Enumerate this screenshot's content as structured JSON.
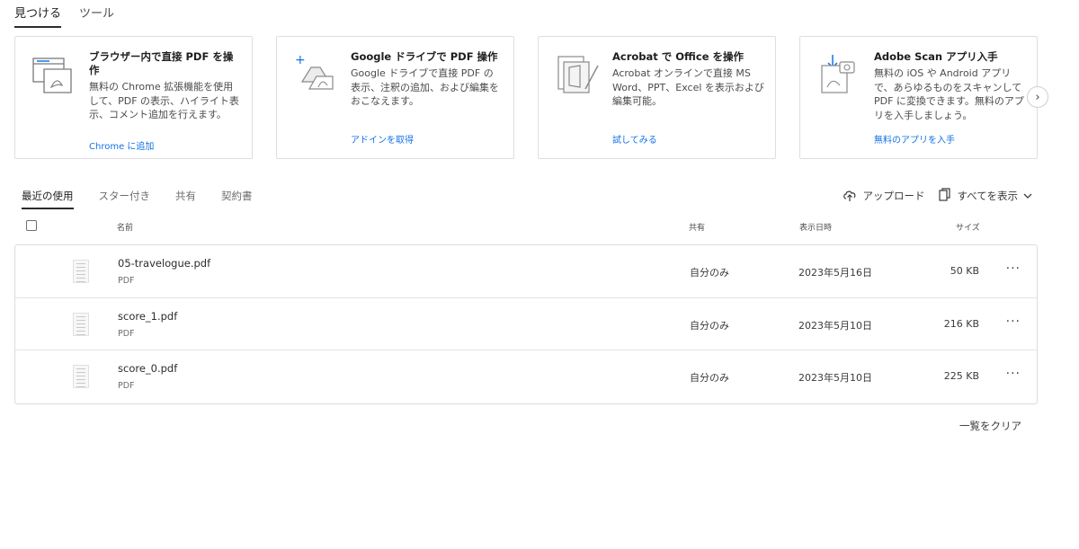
{
  "top_tabs": [
    {
      "label": "見つける"
    },
    {
      "label": "ツール"
    }
  ],
  "cards": [
    {
      "title": "ブラウザー内で直接 PDF を操作",
      "description": "無料の Chrome 拡張機能を使用して、PDF の表示、ハイライト表示、コメント追加を行えます。",
      "link": "Chrome に追加",
      "icon": "browser-pdf-icon"
    },
    {
      "title": "Google ドライブで PDF 操作",
      "description": "Google ドライブで直接 PDF の表示、注釈の追加、および編集をおこなえます。",
      "link": "アドインを取得",
      "icon": "google-drive-pdf-icon"
    },
    {
      "title": "Acrobat で Office を操作",
      "description": "Acrobat オンラインで直接 MS Word、PPT、Excel を表示および編集可能。",
      "link": "試してみる",
      "icon": "office-pdf-icon"
    },
    {
      "title": "Adobe Scan アプリ入手",
      "description": "無料の iOS や Android アプリで、あらゆるものをスキャンして PDF に変換できます。無料のアプリを入手しましょう。",
      "link": "無料のアプリを入手",
      "icon": "scan-app-icon"
    }
  ],
  "section_tabs": [
    {
      "label": "最近の使用"
    },
    {
      "label": "スター付き"
    },
    {
      "label": "共有"
    },
    {
      "label": "契約書"
    }
  ],
  "actions": {
    "upload": "アップロード",
    "show_all": "すべてを表示"
  },
  "table": {
    "headers": {
      "name": "名前",
      "shared": "共有",
      "date": "表示日時",
      "size": "サイズ"
    },
    "rows": [
      {
        "name": "05-travelogue.pdf",
        "type": "PDF",
        "shared": "自分のみ",
        "date": "2023年5月16日",
        "size": "50 KB"
      },
      {
        "name": "score_1.pdf",
        "type": "PDF",
        "shared": "自分のみ",
        "date": "2023年5月10日",
        "size": "216 KB"
      },
      {
        "name": "score_0.pdf",
        "type": "PDF",
        "shared": "自分のみ",
        "date": "2023年5月10日",
        "size": "225 KB"
      }
    ],
    "more_glyph": "···"
  },
  "clear_list": "一覧をクリア",
  "colors": {
    "link": "#1473e6",
    "border": "#dedede"
  }
}
